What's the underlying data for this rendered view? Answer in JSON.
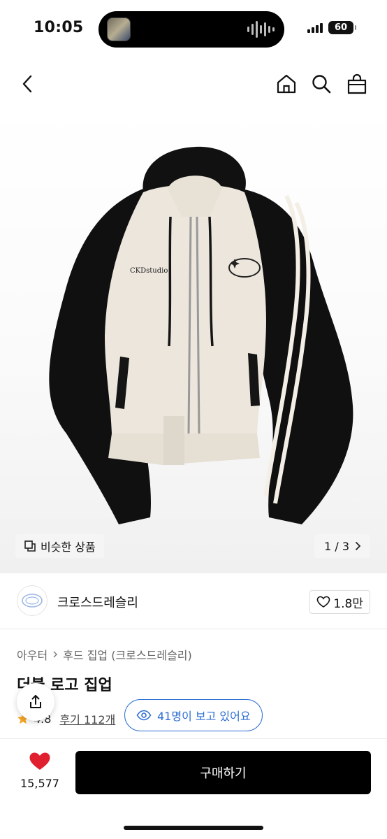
{
  "status_bar": {
    "time": "10:05",
    "battery": "60"
  },
  "hero": {
    "logo_text": "CKDstudio",
    "similar_label": "비슷한 상품",
    "page_indicator": "1 / 3"
  },
  "shop": {
    "name": "크로스드레슬리",
    "likes": "1.8만"
  },
  "product": {
    "breadcrumb": [
      "아우터",
      "후드 집업 (크로스드레슬리)"
    ],
    "title": "더블 로고 집업",
    "rating": "4.8",
    "reviews": "후기 112개",
    "viewers": "41명이 보고 있어요"
  },
  "bottom_bar": {
    "wish_count": "15,577",
    "buy_label": "구매하기"
  },
  "colors": {
    "accent_blue": "#2d6fd3",
    "heart_red": "#e0202e",
    "button_black": "#000000"
  }
}
